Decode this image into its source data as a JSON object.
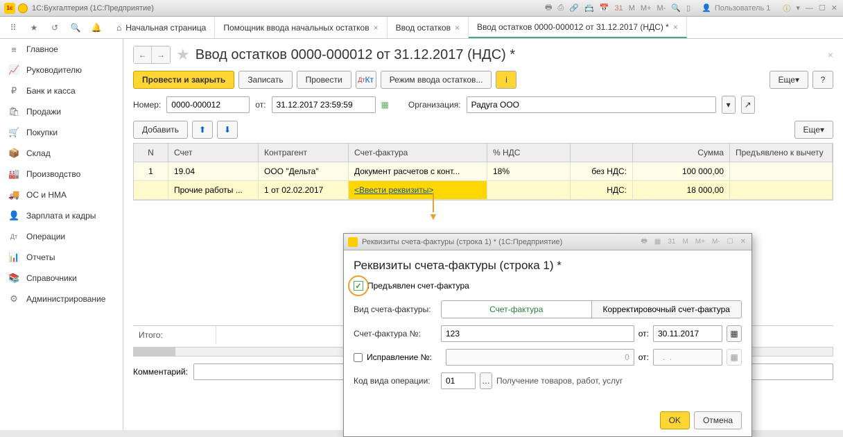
{
  "app": {
    "title": "1С:Бухгалтерия  (1С:Предприятие)",
    "user": "Пользователь 1"
  },
  "tabs": {
    "home": "Начальная страница",
    "t1": "Помощник ввода начальных остатков",
    "t2": "Ввод остатков",
    "t3": "Ввод остатков 0000-000012 от 31.12.2017 (НДС) *"
  },
  "sidebar": [
    {
      "icon": "≡",
      "label": "Главное"
    },
    {
      "icon": "📈",
      "label": "Руководителю"
    },
    {
      "icon": "₽",
      "label": "Банк и касса"
    },
    {
      "icon": "🛍",
      "label": "Продажи"
    },
    {
      "icon": "🛒",
      "label": "Покупки"
    },
    {
      "icon": "📦",
      "label": "Склад"
    },
    {
      "icon": "🏭",
      "label": "Производство"
    },
    {
      "icon": "🚚",
      "label": "ОС и НМА"
    },
    {
      "icon": "👤",
      "label": "Зарплата и кадры"
    },
    {
      "icon": "Дт",
      "label": "Операции"
    },
    {
      "icon": "📊",
      "label": "Отчеты"
    },
    {
      "icon": "📚",
      "label": "Справочники"
    },
    {
      "icon": "⚙",
      "label": "Администрирование"
    }
  ],
  "page": {
    "title": "Ввод остатков 0000-000012 от 31.12.2017 (НДС) *",
    "buttons": {
      "post_close": "Провести и закрыть",
      "save": "Записать",
      "post": "Провести",
      "mode": "Режим ввода остатков...",
      "more": "Еще"
    },
    "fields": {
      "num_lbl": "Номер:",
      "num": "0000-000012",
      "date_lbl": "от:",
      "date": "31.12.2017 23:59:59",
      "org_lbl": "Организация:",
      "org": "Радуга ООО"
    },
    "add": "Добавить",
    "comment_lbl": "Комментарий:",
    "totals_lbl": "Итого:"
  },
  "table": {
    "headers": {
      "n": "N",
      "acc": "Счет",
      "ctr": "Контрагент",
      "inv": "Счет-фактура",
      "vat": "% НДС",
      "sum": "Сумма",
      "ded": "Предъявлено к вычету"
    },
    "rows": [
      {
        "n": "1",
        "acc": "19.04",
        "ctr": "ООО \"Дельта\"",
        "inv": "Документ расчетов с конт...",
        "vat": "18%",
        "lbl": "без НДС:",
        "sum": "100 000,00"
      },
      {
        "n": "",
        "acc": "Прочие работы ...",
        "ctr": "1 от 02.02.2017",
        "inv": "<Ввести реквизиты>",
        "vat": "",
        "lbl": "НДС:",
        "sum": "18 000,00"
      }
    ]
  },
  "dialog": {
    "wintitle": "Реквизиты счета-фактуры (строка 1) *  (1С:Предприятие)",
    "title": "Реквизиты счета-фактуры (строка 1) *",
    "chk": "Предъявлен счет-фактура",
    "type_lbl": "Вид счета-фактуры:",
    "type_a": "Счет-фактура",
    "type_b": "Корректировочный счет-фактура",
    "num_lbl": "Счет-фактура №:",
    "num": "123",
    "date_lbl": "от:",
    "date": "30.11.2017",
    "corr_lbl": "Исправление №:",
    "corr": "0",
    "corr_date_lbl": "от:",
    "corr_date": "  .  .    ",
    "op_lbl": "Код вида операции:",
    "op": "01",
    "op_desc": "Получение товаров, работ, услуг",
    "ok": "OK",
    "cancel": "Отмена"
  }
}
